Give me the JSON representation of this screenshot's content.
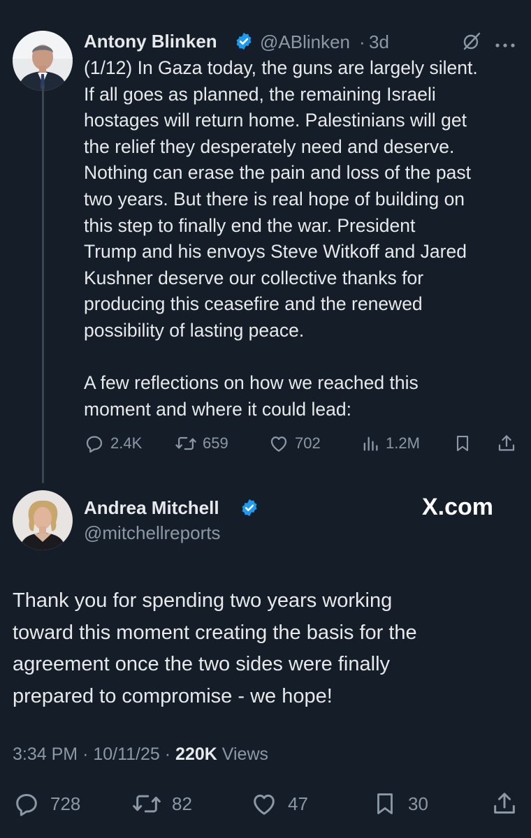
{
  "tweet1": {
    "author_name": "Antony Blinken",
    "handle": "@ABlinken",
    "separator": "·",
    "time": "3d",
    "text_paragraph_1": "(1/12) In Gaza today, the guns are largely silent.\nIf all goes as planned, the remaining Israeli\nhostages will return home. Palestinians will get\nthe relief they desperately need and deserve.\nNothing can erase the pain and loss of the past\ntwo years. But there is real hope of building on\nthis step to finally end the war. President\nTrump and his envoys Steve Witkoff and Jared\nKushner deserve our collective thanks for\nproducing this ceasefire and the renewed\npossibility of lasting peace.",
    "text_paragraph_2": "A few reflections on how we reached this\nmoment and where it could lead:",
    "replies": "2.4K",
    "reposts": "659",
    "likes": "702",
    "views": "1.2M",
    "verified_color": "#1d9bf0",
    "icons": [
      "grok-icon",
      "more-icon",
      "reply-icon",
      "repost-icon",
      "like-icon",
      "views-icon",
      "bookmark-icon",
      "share-icon"
    ]
  },
  "tweet2": {
    "author_name": "Andrea Mitchell",
    "handle": "@mitchellreports",
    "brand": "X.com",
    "text": "Thank you for spending two years working\ntoward this moment creating the basis for the\nagreement once the two sides were finally\nprepared to compromise - we hope!",
    "time": "3:34 PM",
    "date": "10/11/25",
    "separator": "·",
    "views_count": "220K",
    "views_label": "Views",
    "replies": "728",
    "reposts": "82",
    "likes": "47",
    "bookmarks": "30"
  },
  "colors": {
    "background": "#151d28",
    "text": "#e7e9ea",
    "muted": "#8b98a5",
    "accent": "#1d9bf0",
    "thread_line": "#3b4652"
  }
}
